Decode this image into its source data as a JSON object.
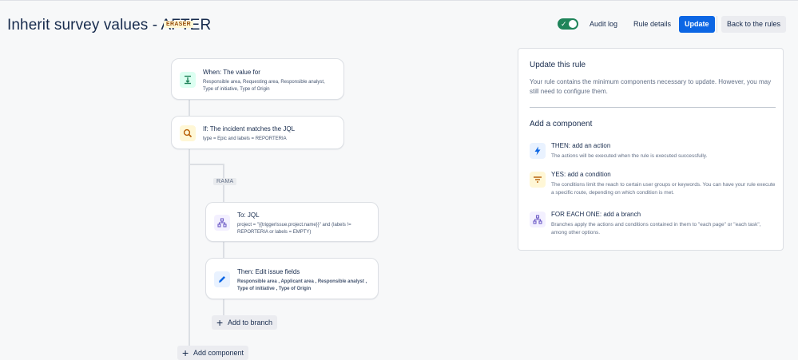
{
  "header": {
    "title": "Inherit survey values - AFTER",
    "badge": "ERASER",
    "toggle_state": "on",
    "audit_log": "Audit log",
    "rule_details": "Rule details",
    "update": "Update",
    "back": "Back to the rules"
  },
  "flow": {
    "trigger": {
      "title": "When: The value for",
      "description": "Responsible area, Requesting area, Responsible analyst, Type of initiative, Type of Origin",
      "icon": "field-value-icon"
    },
    "condition": {
      "title": "If: The incident matches the JQL",
      "description": "type = Epic and labels = REPORTERIA",
      "icon": "search-icon"
    },
    "branch_label": "RAMA",
    "branch": {
      "title": "To: JQL",
      "description": "project = \"{{triggerIssue.project.name}}\" and (labels != REPORTERIA or labels = EMPTY)",
      "icon": "branch-icon"
    },
    "action": {
      "title": "Then: Edit issue fields",
      "description": "Responsible area , Applicant area , Responsible analyst , Type of initiative , Type of Origin",
      "icon": "pencil-icon"
    },
    "add_to_branch": "Add to branch",
    "add_component": "Add component"
  },
  "panel": {
    "title": "Update this rule",
    "description": "Your rule contains the minimum components necessary to update. However, you may still need to configure them.",
    "subtitle": "Add a component",
    "components": [
      {
        "title": "THEN: add an action",
        "description": "The actions will be executed when the rule is executed successfully.",
        "icon": "lightning-icon"
      },
      {
        "title": "YES: add a condition",
        "description": "The conditions limit the reach to certain user groups or keywords. You can have your rule execute a specific route, depending on which condition is met.",
        "icon": "filter-icon"
      },
      {
        "title": "FOR EACH ONE: add a branch",
        "description": "Branches apply the actions and conditions contained in them to \"each page\" or \"each task\", among other options.",
        "icon": "branch-icon"
      }
    ]
  },
  "colors": {
    "primary": "#0c66e4",
    "toggle_on": "#1f845a",
    "trigger_icon_bg": "#dcfff1",
    "condition_icon_bg": "#fff7d6",
    "branch_icon_bg": "#f3f0ff",
    "action_icon_bg": "#e9f2ff"
  }
}
